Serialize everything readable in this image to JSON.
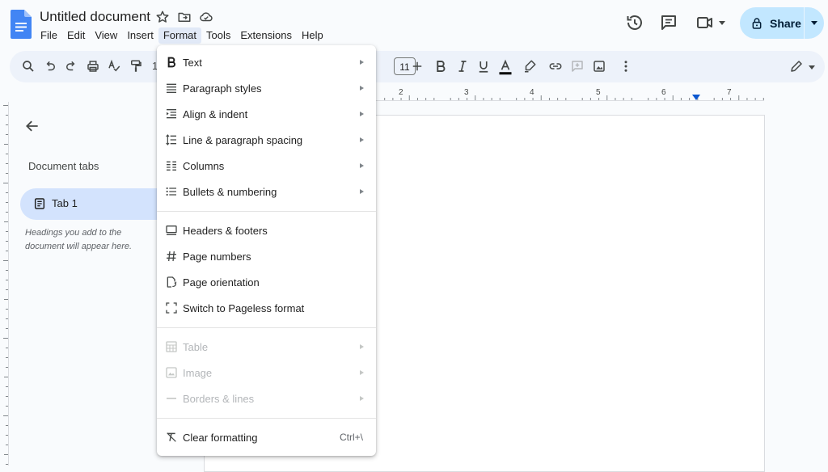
{
  "app": {
    "doc_title": "Untitled document",
    "menu": [
      "File",
      "Edit",
      "View",
      "Insert",
      "Format",
      "Tools",
      "Extensions",
      "Help"
    ],
    "active_menu": "Format"
  },
  "header": {
    "share_label": "Share"
  },
  "toolbar": {
    "font_size": "11",
    "partial_zoom_digit": "1"
  },
  "ruler": {
    "marks": [
      "2",
      "3",
      "4",
      "5",
      "6",
      "7"
    ]
  },
  "sidebar": {
    "heading": "Document tabs",
    "tab_label": "Tab 1",
    "hint": "Headings you add to the document will appear here."
  },
  "format_menu": {
    "sections": [
      [
        {
          "label": "Text",
          "icon": "bold-icon",
          "submenu": true
        },
        {
          "label": "Paragraph styles",
          "icon": "paragraph-styles-icon",
          "submenu": true
        },
        {
          "label": "Align & indent",
          "icon": "align-indent-icon",
          "submenu": true
        },
        {
          "label": "Line & paragraph spacing",
          "icon": "line-spacing-icon",
          "submenu": true
        },
        {
          "label": "Columns",
          "icon": "columns-icon",
          "submenu": true
        },
        {
          "label": "Bullets & numbering",
          "icon": "bulleted-list-icon",
          "submenu": true
        }
      ],
      [
        {
          "label": "Headers & footers",
          "icon": "header-footer-icon"
        },
        {
          "label": "Page numbers",
          "icon": "hash-icon"
        },
        {
          "label": "Page orientation",
          "icon": "page-orientation-icon"
        },
        {
          "label": "Switch to Pageless format",
          "icon": "pageless-icon"
        }
      ],
      [
        {
          "label": "Table",
          "icon": "table-icon",
          "submenu": true,
          "disabled": true
        },
        {
          "label": "Image",
          "icon": "image-icon",
          "submenu": true,
          "disabled": true
        },
        {
          "label": "Borders & lines",
          "icon": "border-line-icon",
          "submenu": true,
          "disabled": true
        }
      ],
      [
        {
          "label": "Clear formatting",
          "icon": "clear-formatting-icon",
          "shortcut": "Ctrl+\\"
        }
      ]
    ]
  },
  "colors": {
    "accent": "#0b57d0",
    "share_bg": "#c2e7ff",
    "active_tab_bg": "#d3e3fd",
    "menu_highlight": "#e1e9f7",
    "text_color_underline": "#000000"
  }
}
